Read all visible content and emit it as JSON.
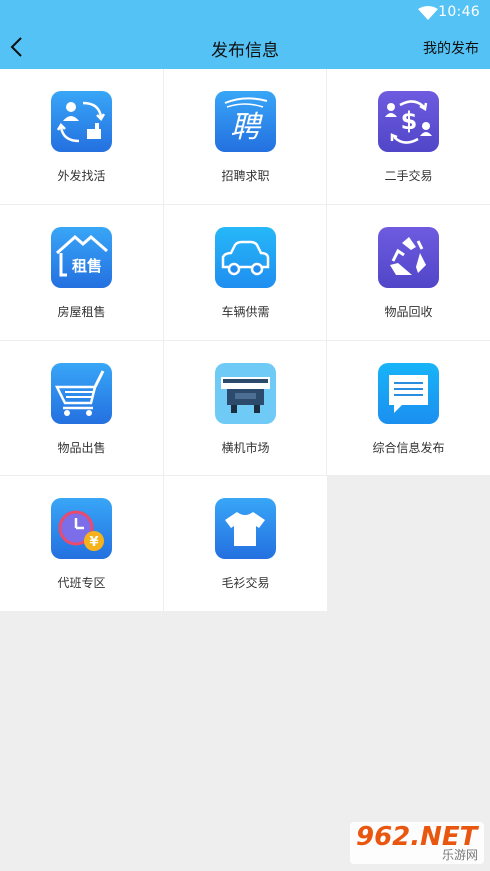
{
  "status": {
    "time": "10:46"
  },
  "nav": {
    "title": "发布信息",
    "right": "我的发布"
  },
  "items": [
    {
      "label": "外发找活",
      "icon": "outsource-work-icon"
    },
    {
      "label": "招聘求职",
      "icon": "recruitment-icon"
    },
    {
      "label": "二手交易",
      "icon": "second-hand-trade-icon"
    },
    {
      "label": "房屋租售",
      "icon": "house-rent-sale-icon"
    },
    {
      "label": "车辆供需",
      "icon": "car-icon"
    },
    {
      "label": "物品回收",
      "icon": "recycle-icon"
    },
    {
      "label": "物品出售",
      "icon": "shopping-cart-icon"
    },
    {
      "label": "横机市场",
      "icon": "knitting-machine-icon"
    },
    {
      "label": "综合信息发布",
      "icon": "message-icon"
    },
    {
      "label": "代班专区",
      "icon": "shift-clock-icon"
    },
    {
      "label": "毛衫交易",
      "icon": "tshirt-icon"
    }
  ],
  "icon_text": {
    "recruit_char": "聘",
    "house_text": "租售",
    "yen": "¥"
  },
  "watermark": {
    "big": "962.NET",
    "small": "乐游网"
  },
  "colors": {
    "header": "#54c2f5",
    "page_bg": "#efeeee",
    "icon_blue": "#2f86e8"
  }
}
